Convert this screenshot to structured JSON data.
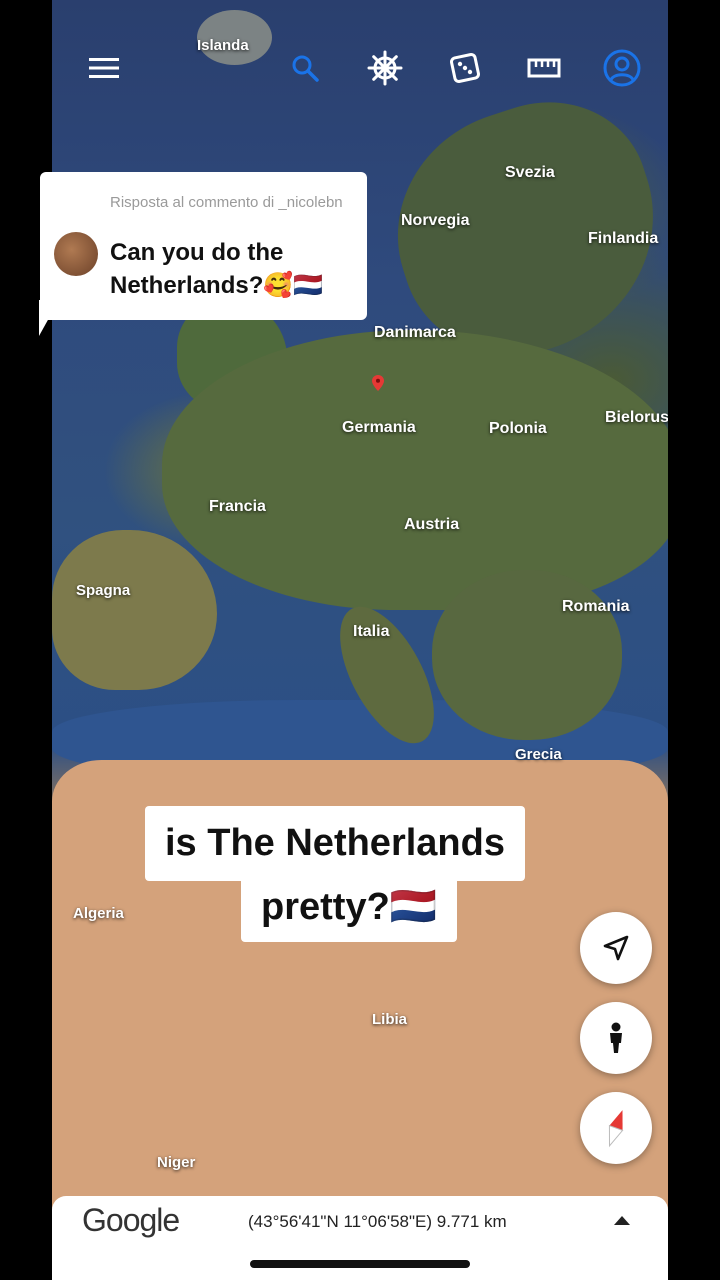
{
  "toolbar": {
    "icons": [
      "menu-icon",
      "search-icon",
      "voyager-helm-icon",
      "dice-icon",
      "ruler-icon",
      "account-icon"
    ],
    "accent": "#1a73e8"
  },
  "map": {
    "labels": {
      "islanda": "Islanda",
      "svezia": "Svezia",
      "norvegia": "Norvegia",
      "finlandia": "Finlandia",
      "danimarca": "Danimarca",
      "germania": "Germania",
      "polonia": "Polonia",
      "bielorussia": "Bielorus",
      "francia": "Francia",
      "austria": "Austria",
      "spagna": "Spagna",
      "romania": "Romania",
      "italia": "Italia",
      "grecia": "Grecia",
      "algeria": "Algeria",
      "libia": "Libia",
      "niger": "Niger"
    },
    "pin_color": "#e53935"
  },
  "comment": {
    "reply_to": "Risposta al commento di _nicolebn",
    "text": "Can you do the Netherlands?🥰🇳🇱"
  },
  "caption": {
    "line1": "is The Netherlands",
    "line2": "pretty?🇳🇱"
  },
  "fabs": [
    "navigate-icon",
    "pegman-icon",
    "compass-icon"
  ],
  "bottom_bar": {
    "logo": "Google",
    "coordinates": "(43°56'41\"N 11°06'58\"E) 9.771 km"
  }
}
